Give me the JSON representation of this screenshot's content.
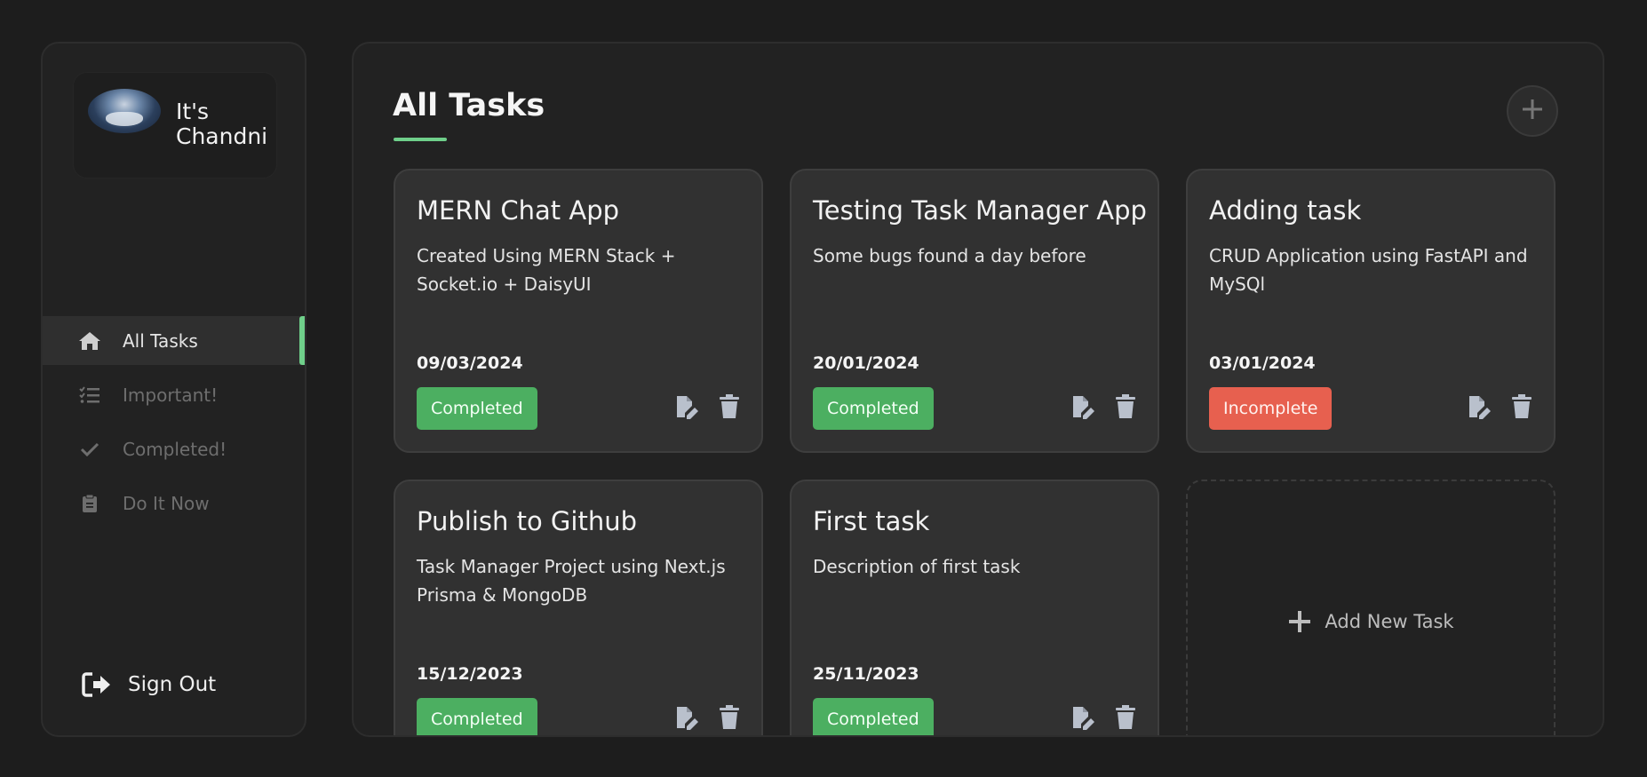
{
  "sidebar": {
    "profile_name": "It's Chandni",
    "nav": [
      {
        "label": "All Tasks",
        "icon": "home-icon",
        "active": true
      },
      {
        "label": "Important!",
        "icon": "list-check-icon",
        "active": false
      },
      {
        "label": "Completed!",
        "icon": "check-icon",
        "active": false
      },
      {
        "label": "Do It Now",
        "icon": "clipboard-icon",
        "active": false
      }
    ],
    "signout_label": "Sign Out"
  },
  "main": {
    "title": "All Tasks",
    "add_new_label": "Add New Task",
    "tasks": [
      {
        "title": "MERN Chat App",
        "description": "Created Using MERN Stack + Socket.io + DaisyUI",
        "date": "09/03/2024",
        "status": "Completed"
      },
      {
        "title": "Testing Task Manager App",
        "description": "Some bugs found a day before",
        "date": "20/01/2024",
        "status": "Completed"
      },
      {
        "title": "Adding task",
        "description": "CRUD Application using FastAPI and MySQl",
        "date": "03/01/2024",
        "status": "Incomplete"
      },
      {
        "title": "Publish to Github",
        "description": "Task Manager Project using Next.js Prisma & MongoDB",
        "date": "15/12/2023",
        "status": "Completed"
      },
      {
        "title": "First task",
        "description": "Description of first task",
        "date": "25/11/2023",
        "status": "Completed"
      }
    ]
  },
  "colors": {
    "background": "#1d1d1d",
    "panel": "#222222",
    "card": "#313131",
    "accent": "#6fcf8a",
    "completed": "#4caf61",
    "incomplete": "#e7604f"
  }
}
